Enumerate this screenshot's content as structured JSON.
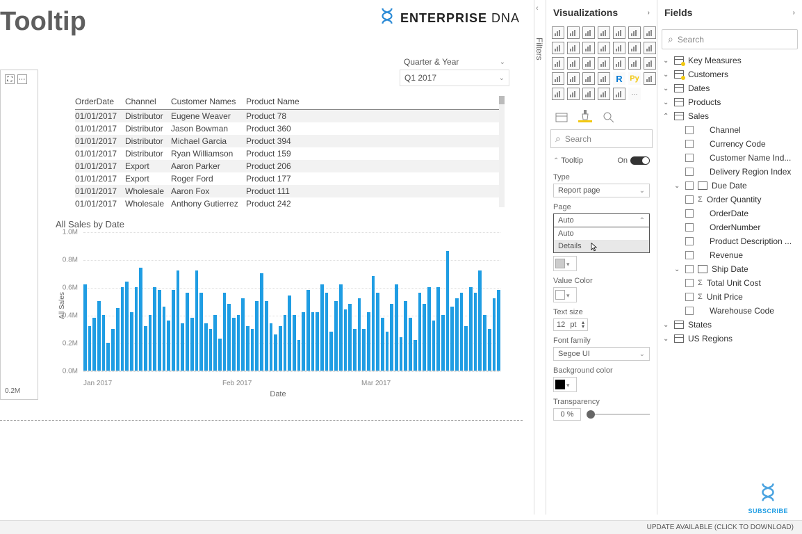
{
  "page_title": "Tooltip",
  "logo": {
    "brand": "ENTERPRISE",
    "suffix": "DNA"
  },
  "slicer": {
    "label": "Quarter & Year",
    "value": "Q1 2017"
  },
  "visual_frame": {
    "footer_label": "0.2M"
  },
  "table": {
    "headers": {
      "date": "OrderDate",
      "channel": "Channel",
      "customer": "Customer Names",
      "product": "Product Name"
    },
    "rows": [
      {
        "date": "01/01/2017",
        "channel": "Distributor",
        "customer": "Eugene Weaver",
        "product": "Product 78"
      },
      {
        "date": "01/01/2017",
        "channel": "Distributor",
        "customer": "Jason Bowman",
        "product": "Product 360"
      },
      {
        "date": "01/01/2017",
        "channel": "Distributor",
        "customer": "Michael Garcia",
        "product": "Product 394"
      },
      {
        "date": "01/01/2017",
        "channel": "Distributor",
        "customer": "Ryan Williamson",
        "product": "Product 159"
      },
      {
        "date": "01/01/2017",
        "channel": "Export",
        "customer": "Aaron Parker",
        "product": "Product 206"
      },
      {
        "date": "01/01/2017",
        "channel": "Export",
        "customer": "Roger Ford",
        "product": "Product 177"
      },
      {
        "date": "01/01/2017",
        "channel": "Wholesale",
        "customer": "Aaron Fox",
        "product": "Product 111"
      },
      {
        "date": "01/01/2017",
        "channel": "Wholesale",
        "customer": "Anthony Gutierrez",
        "product": "Product 242"
      }
    ]
  },
  "chart_data": {
    "type": "bar",
    "title": "All Sales by Date",
    "ylabel": "All Sales",
    "xlabel": "Date",
    "ylim": [
      0,
      1000000
    ],
    "y_ticks": [
      "0.0M",
      "0.2M",
      "0.4M",
      "0.6M",
      "0.8M",
      "1.0M"
    ],
    "x_ticks": [
      "Jan 2017",
      "Feb 2017",
      "Mar 2017"
    ],
    "values_millions": [
      0.62,
      0.32,
      0.38,
      0.5,
      0.4,
      0.2,
      0.3,
      0.45,
      0.6,
      0.64,
      0.42,
      0.6,
      0.74,
      0.32,
      0.4,
      0.6,
      0.58,
      0.46,
      0.36,
      0.58,
      0.72,
      0.34,
      0.56,
      0.38,
      0.72,
      0.56,
      0.34,
      0.3,
      0.4,
      0.23,
      0.56,
      0.48,
      0.38,
      0.4,
      0.52,
      0.32,
      0.3,
      0.5,
      0.7,
      0.5,
      0.34,
      0.26,
      0.32,
      0.4,
      0.54,
      0.4,
      0.22,
      0.42,
      0.58,
      0.42,
      0.42,
      0.62,
      0.56,
      0.28,
      0.5,
      0.62,
      0.44,
      0.48,
      0.3,
      0.52,
      0.3,
      0.42,
      0.68,
      0.56,
      0.38,
      0.28,
      0.48,
      0.62,
      0.24,
      0.5,
      0.38,
      0.22,
      0.56,
      0.48,
      0.6,
      0.36,
      0.6,
      0.4,
      0.86,
      0.46,
      0.52,
      0.56,
      0.32,
      0.6,
      0.56,
      0.72,
      0.4,
      0.3,
      0.52,
      0.58
    ]
  },
  "filters_tab": "Filters",
  "viz_panel": {
    "title": "Visualizations",
    "search_placeholder": "Search",
    "section": {
      "name": "Tooltip",
      "state": "On"
    },
    "props": {
      "type_label": "Type",
      "type_value": "Report page",
      "page_label": "Page",
      "page_value": "Auto",
      "page_options": [
        "Auto",
        "Details"
      ],
      "value_color_label": "Value Color",
      "text_size_label": "Text size",
      "text_size_value": "12",
      "text_size_unit": "pt",
      "font_family_label": "Font family",
      "font_family_value": "Segoe UI",
      "bg_color_label": "Background color",
      "transparency_label": "Transparency",
      "transparency_value": "0",
      "transparency_unit": "%"
    }
  },
  "fields_panel": {
    "title": "Fields",
    "search_placeholder": "Search",
    "tables": [
      {
        "name": "Key Measures",
        "badge": true,
        "expand": "closed"
      },
      {
        "name": "Customers",
        "badge": true,
        "expand": "closed"
      },
      {
        "name": "Dates",
        "expand": "closed"
      },
      {
        "name": "Products",
        "expand": "closed"
      },
      {
        "name": "Sales",
        "expand": "open",
        "fields": [
          {
            "name": "Channel"
          },
          {
            "name": "Currency Code"
          },
          {
            "name": "Customer Name Ind..."
          },
          {
            "name": "Delivery Region Index"
          },
          {
            "name": "Due Date",
            "type": "date-hier",
            "expand": true
          },
          {
            "name": "Order Quantity",
            "sigma": true
          },
          {
            "name": "OrderDate"
          },
          {
            "name": "OrderNumber"
          },
          {
            "name": "Product Description ..."
          },
          {
            "name": "Revenue"
          },
          {
            "name": "Ship Date",
            "type": "date-hier",
            "expand": true
          },
          {
            "name": "Total Unit Cost",
            "sigma": true
          },
          {
            "name": "Unit Price",
            "sigma": true
          },
          {
            "name": "Warehouse Code"
          }
        ]
      },
      {
        "name": "States",
        "expand": "closed"
      },
      {
        "name": "US Regions",
        "expand": "closed"
      }
    ]
  },
  "subscribe": "SUBSCRIBE",
  "statusbar": "UPDATE AVAILABLE (CLICK TO DOWNLOAD)"
}
